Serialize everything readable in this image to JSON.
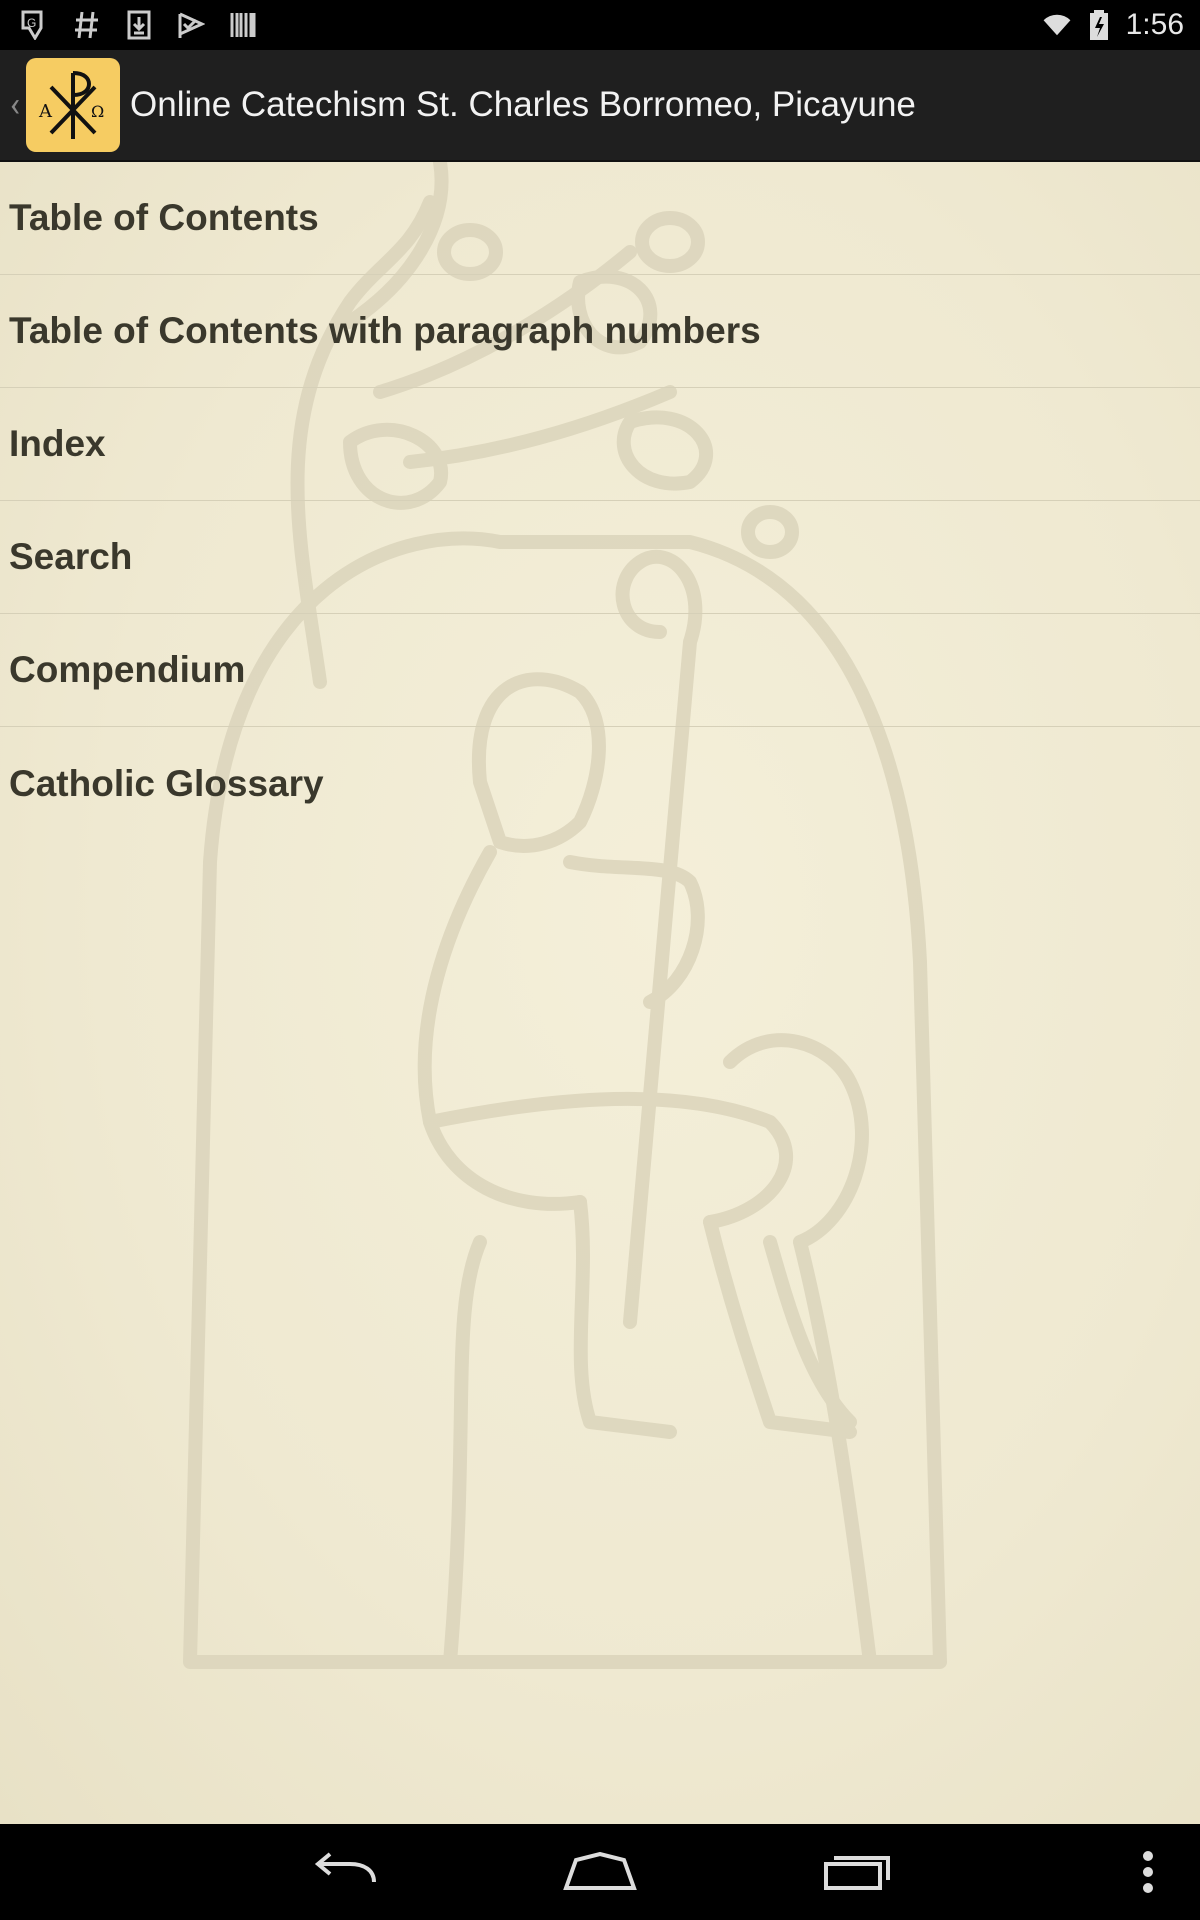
{
  "status_bar": {
    "time": "1:56",
    "left_icons": [
      "location-icon",
      "hash-icon",
      "download-icon",
      "check-flag-icon",
      "barcode-icon"
    ],
    "right_icons": [
      "wifi-icon",
      "battery-icon"
    ]
  },
  "action_bar": {
    "title": "Online Catechism St. Charles Borromeo, Picayune",
    "icon": "chi-rho-icon",
    "icon_color": "#f6cc62"
  },
  "menu": {
    "items": [
      {
        "label": "Table of Contents"
      },
      {
        "label": "Table of Contents with paragraph numbers"
      },
      {
        "label": "Index"
      },
      {
        "label": "Search"
      },
      {
        "label": "Compendium"
      },
      {
        "label": "Catholic Glossary"
      }
    ]
  },
  "nav_bar": {
    "buttons": [
      "back-icon",
      "home-icon",
      "recents-icon",
      "overflow-menu-icon"
    ]
  },
  "colors": {
    "background": "#efe9d1",
    "text": "#3a382c",
    "action_bar": "#1f1f1f"
  }
}
